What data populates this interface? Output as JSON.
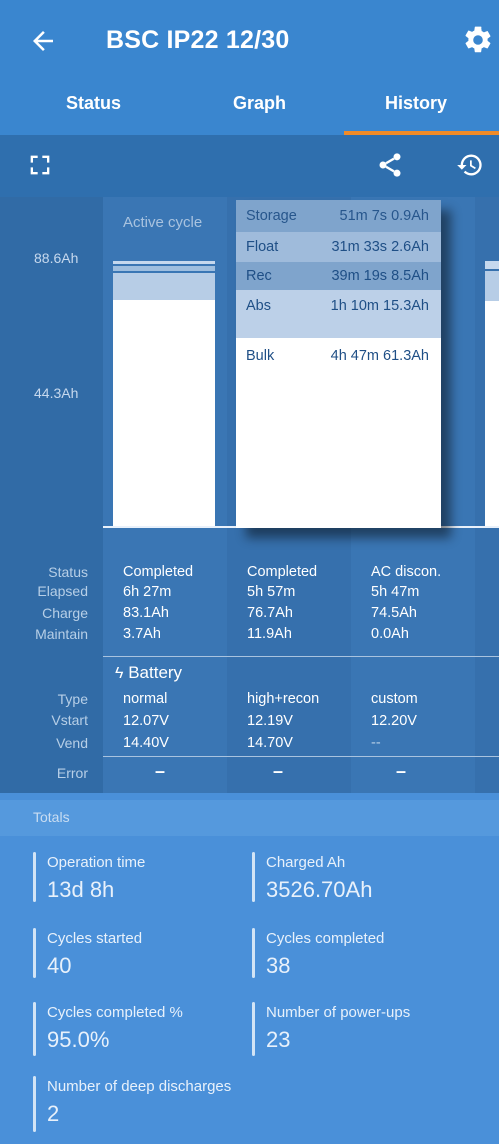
{
  "header": {
    "title": "BSC IP22 12/30",
    "tabs": [
      {
        "label": "Status"
      },
      {
        "label": "Graph"
      },
      {
        "label": "History",
        "active": true
      }
    ]
  },
  "toolbar": {
    "icons": [
      "fullscreen-icon",
      "share-icon",
      "history-icon"
    ]
  },
  "chart": {
    "y_labels": [
      "88.6Ah",
      "44.3Ah"
    ],
    "active_cycle_label": "Active cycle",
    "tooltip": [
      {
        "phase": "Storage",
        "time": "51m 7s",
        "ah": "0.9Ah"
      },
      {
        "phase": "Float",
        "time": "31m 33s",
        "ah": "2.6Ah"
      },
      {
        "phase": "Rec",
        "time": "39m 19s",
        "ah": "8.5Ah"
      },
      {
        "phase": "Abs",
        "time": "1h 10m",
        "ah": "15.3Ah"
      },
      {
        "phase": "Bulk",
        "time": "4h 47m",
        "ah": "61.3Ah"
      }
    ]
  },
  "table": {
    "row_labels": [
      "Status",
      "Elapsed",
      "Charge",
      "Maintain"
    ],
    "columns": [
      {
        "status": "Completed",
        "elapsed": "6h 27m",
        "charge": "83.1Ah",
        "maintain": "3.7Ah",
        "type": "normal",
        "vstart": "12.07V",
        "vend": "14.40V",
        "error": "–"
      },
      {
        "status": "Completed",
        "elapsed": "5h 57m",
        "charge": "76.7Ah",
        "maintain": "11.9Ah",
        "type": "high+recon",
        "vstart": "12.19V",
        "vend": "14.70V",
        "error": "–"
      },
      {
        "status": "AC discon.",
        "elapsed": "5h 47m",
        "charge": "74.5Ah",
        "maintain": "0.0Ah",
        "type": "custom",
        "vstart": "12.20V",
        "vend": "--",
        "error": "–"
      }
    ],
    "battery_section": "Battery",
    "battery_row_labels": [
      "Type",
      "Vstart",
      "Vend"
    ],
    "error_label": "Error"
  },
  "totals": {
    "header": "Totals",
    "stats": [
      {
        "label": "Operation time",
        "value": "13d 8h"
      },
      {
        "label": "Charged Ah",
        "value": "3526.70Ah"
      },
      {
        "label": "Cycles started",
        "value": "40"
      },
      {
        "label": "Cycles completed",
        "value": "38"
      },
      {
        "label": "Cycles completed %",
        "value": "95.0%"
      },
      {
        "label": "Number of power-ups",
        "value": "23"
      },
      {
        "label": "Number of deep discharges",
        "value": "2"
      }
    ]
  },
  "colors": {
    "appbar": "#3a86cf",
    "accent_underline": "#f08b28",
    "history_bg": "#316ba6",
    "totals_bg": "#4a90d9"
  }
}
